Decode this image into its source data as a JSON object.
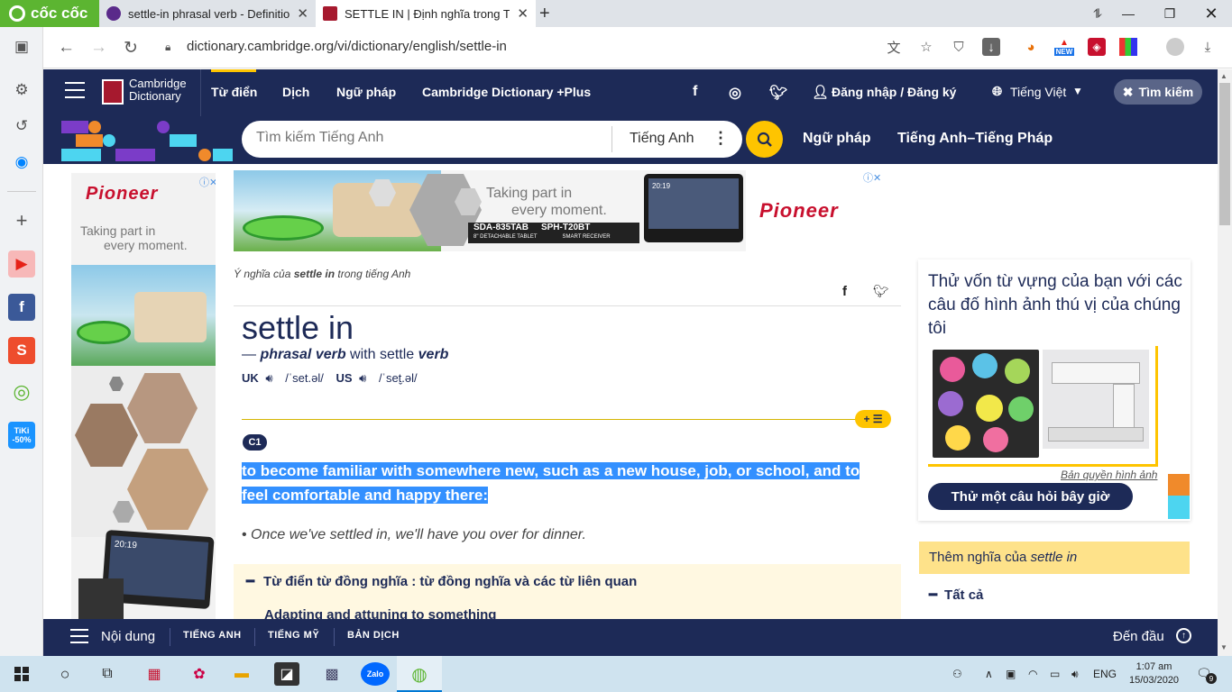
{
  "browser": {
    "brand": "cốc cốc",
    "tabs": [
      {
        "title": "settle-in phrasal verb - Definitio",
        "active": false
      },
      {
        "title": "SETTLE IN | Định nghĩa trong Từ",
        "active": true
      }
    ],
    "url": "dictionary.cambridge.org/vi/dictionary/english/settle-in",
    "new_badge": "NEW",
    "colors": {
      "coccoc_green": "#5cb531"
    }
  },
  "left_sidebar": {
    "items": [
      "apps-icon",
      "settings-icon",
      "history-icon",
      "messenger-icon",
      "add-icon",
      "youtube-icon",
      "facebook-icon",
      "shopee-icon",
      "coccoc-map-icon"
    ],
    "tiki_badge": {
      "line1": "TiKi",
      "line2": "-50%"
    }
  },
  "header": {
    "logo_line1": "Cambridge",
    "logo_line2": "Dictionary",
    "nav": [
      "Từ điển",
      "Dịch",
      "Ngữ pháp",
      "Cambridge Dictionary +Plus"
    ],
    "login": "Đăng nhập / Đăng ký",
    "language": "Tiếng Việt",
    "search_toggle": "Tìm kiếm",
    "colors": {
      "navy": "#1d2a57",
      "yellow": "#fec400"
    }
  },
  "search": {
    "placeholder": "Tìm kiếm Tiếng Anh",
    "dictionary": "Tiếng Anh",
    "links": [
      "Ngữ pháp",
      "Tiếng Anh–Tiếng Pháp"
    ]
  },
  "ads": {
    "brand": "Pioneer",
    "tagline_line1": "Taking part in",
    "tagline_line2": "every moment.",
    "product1": "SDA-835TAB",
    "product1_sub": "8\" DETACHABLE TABLET",
    "product2": "SPH-T20BT",
    "product2_sub": "SMART RECEIVER",
    "screen_time": "20:19"
  },
  "entry": {
    "crumb_prefix": "Ý nghĩa của ",
    "crumb_word": "settle in",
    "crumb_suffix": " trong tiếng Anh",
    "headword": "settle in",
    "pos_dash": "— ",
    "pos": "phrasal verb",
    "pos_with": " with settle ",
    "pos_verb": "verb",
    "uk_label": "UK",
    "uk_ipa": "/ˈset.əl/",
    "us_label": "US",
    "us_ipa": "/ˈset̬.əl/",
    "level": "C1",
    "definition": "to become familiar with somewhere new, such as a new house, job, or school, and to feel comfortable and happy there:",
    "example": "Once we've settled in, we'll have you over for dinner.",
    "thesaurus_title": "Từ điển từ đồng nghĩa : từ đồng nghĩa và các từ liên quan",
    "thesaurus_item": "Adapting and attuning to something"
  },
  "quiz": {
    "title": "Thử vốn từ vựng của bạn với các câu đố hình ảnh thú vị của chúng tôi",
    "credit": "Bản quyền hình ảnh",
    "button": "Thử một câu hỏi bây giờ"
  },
  "more_meanings": {
    "prefix": "Thêm nghĩa của ",
    "word": "settle in",
    "item": "Tất cả"
  },
  "bottom_bar": {
    "contents": "Nội dung",
    "tabs": [
      "TIẾNG ANH",
      "TIẾNG MỸ",
      "BẢN DỊCH"
    ],
    "to_top": "Đến đầu"
  },
  "taskbar": {
    "apps": [
      "start-icon",
      "cortana-icon",
      "task-view-icon",
      "app1-icon",
      "app2-icon",
      "explorer-icon",
      "app3-icon",
      "app4-icon",
      "zalo-icon",
      "coccoc-icon"
    ],
    "zalo_label": "Zalo",
    "ime": "ENG",
    "time": "1:07 am",
    "date": "15/03/2020",
    "notifications": "9"
  }
}
